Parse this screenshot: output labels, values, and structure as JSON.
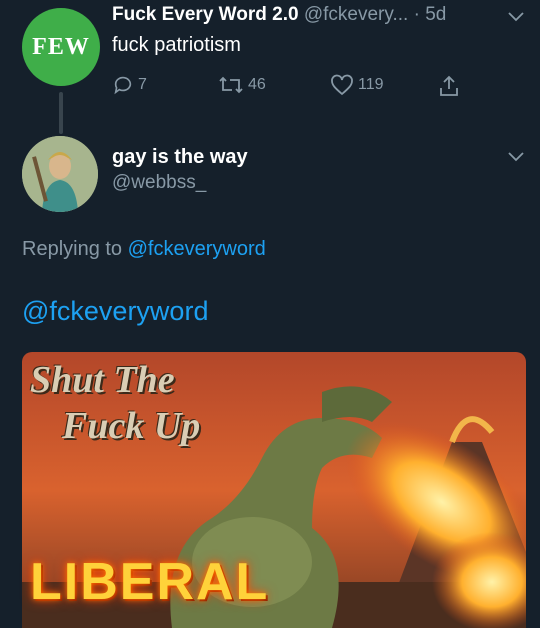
{
  "parent_tweet": {
    "avatar_text": "FEW",
    "display_name": "Fuck Every Word 2.0",
    "handle": "@fckevery...",
    "time": "· 5d",
    "text": "fuck patriotism",
    "actions": {
      "replies": "7",
      "retweets": "46",
      "likes": "119"
    }
  },
  "reply_tweet": {
    "display_name": "gay is the way",
    "handle": "@webbss_",
    "replying_prefix": "Replying to",
    "replying_to": "@fckeveryword",
    "text": "@fckeveryword",
    "image": {
      "line1": "Shut The",
      "line2": "Fuck Up",
      "line3": "LIBERAL"
    }
  },
  "colors": {
    "background": "#15202b",
    "muted": "#8899a6",
    "link": "#1da1f2",
    "few_green": "#3fae49"
  }
}
